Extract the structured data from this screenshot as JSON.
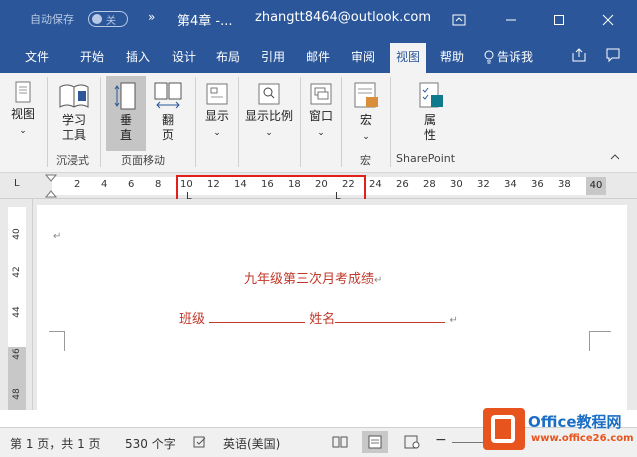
{
  "titlebar": {
    "autosave": "自动保存",
    "autosave_state": "关",
    "more": "»",
    "doc_title": "第4章 -...",
    "user": "zhangtt8464@outlook.com"
  },
  "tabs": [
    "文件",
    "开始",
    "插入",
    "设计",
    "布局",
    "引用",
    "邮件",
    "审阅",
    "视图",
    "帮助"
  ],
  "active_tab": "视图",
  "tell_me": "告诉我",
  "ribbon": {
    "view_btn": "视图",
    "learn_tool_1": "学习",
    "learn_tool_2": "工具",
    "group_immersive": "沉浸式",
    "vertical_1": "垂",
    "vertical_2": "直",
    "flip_1": "翻",
    "flip_2": "页",
    "group_page_move": "页面移动",
    "show": "显示",
    "zoom": "显示比例",
    "window": "窗口",
    "macro": "宏",
    "group_macro": "宏",
    "props_1": "属",
    "props_2": "性",
    "group_sharepoint": "SharePoint"
  },
  "ruler": {
    "tab_marker": "L",
    "numbers": [
      "2",
      "4",
      "6",
      "8",
      "10",
      "12",
      "14",
      "16",
      "18",
      "20",
      "22",
      "24",
      "26",
      "28",
      "30",
      "32",
      "34",
      "36",
      "38"
    ],
    "end": "40"
  },
  "vruler": [
    "40",
    "42",
    "44",
    "46",
    "48"
  ],
  "document": {
    "title": "九年级第三次月考成绩",
    "class_label": "班级",
    "name_label": "姓名"
  },
  "status": {
    "page": "第 1 页，共 1 页",
    "words": "530 个字",
    "language": "英语(美国)"
  },
  "watermark": {
    "title": "Office教程网",
    "url": "www.office26.com"
  },
  "colors": {
    "brand": "#2b579a",
    "doc_text": "#c0392b",
    "highlight_box": "#e0211b"
  }
}
